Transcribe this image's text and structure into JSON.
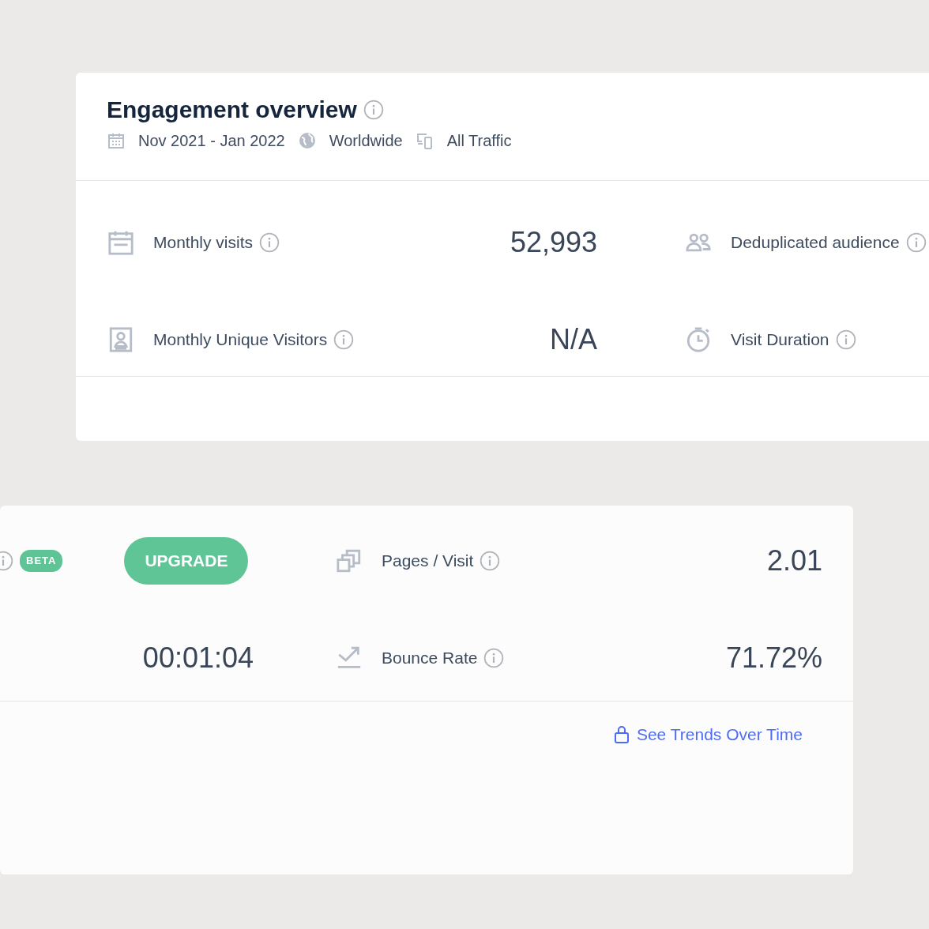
{
  "overview_card": {
    "title": "Engagement overview",
    "filters": [
      {
        "kind": "date",
        "label": "Nov 2021 - Jan 2022"
      },
      {
        "kind": "region",
        "label": "Worldwide"
      },
      {
        "kind": "traffic",
        "label": "All Traffic"
      }
    ],
    "metrics": [
      {
        "kind": "visits",
        "label": "Monthly visits",
        "value": "52,993"
      },
      {
        "kind": "audience",
        "label": "Deduplicated audience"
      },
      {
        "kind": "unique",
        "label": "Monthly Unique Visitors",
        "value": "N/A"
      },
      {
        "kind": "duration",
        "label": "Visit Duration"
      }
    ]
  },
  "detail_card": {
    "rows": [
      {
        "badge": "BETA",
        "button": "UPGRADE",
        "kind": "pages",
        "label": "Pages / Visit",
        "value": "2.01"
      },
      {
        "left_value": "00:01:04",
        "kind": "bounce",
        "label": "Bounce Rate",
        "value": "71.72%"
      }
    ],
    "footer_link": "See Trends Over Time"
  }
}
